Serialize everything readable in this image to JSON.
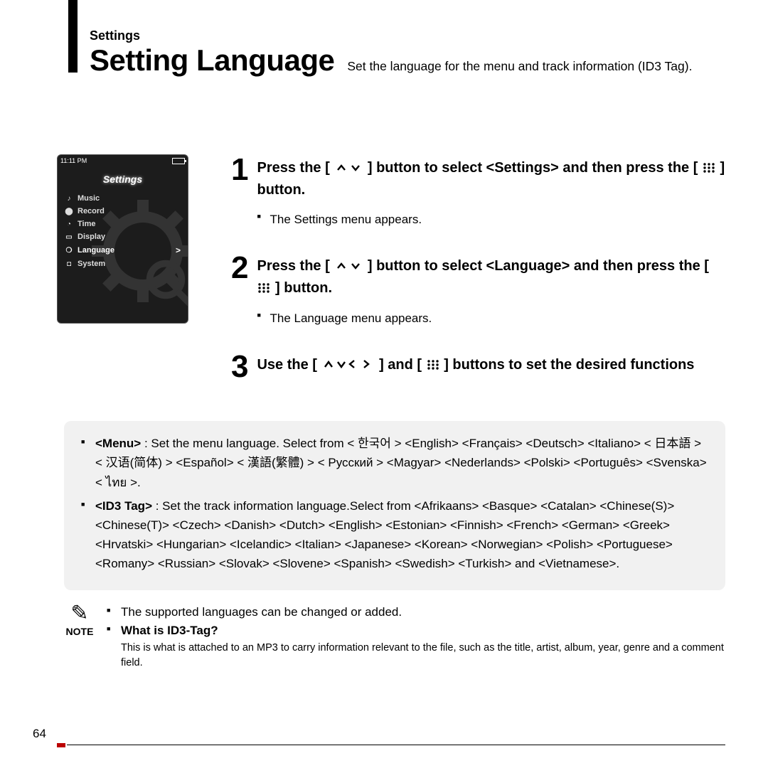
{
  "header": {
    "breadcrumb": "Settings",
    "title": "Setting Language",
    "subtitle": "Set the language for the menu and track information (ID3 Tag)."
  },
  "device": {
    "time": "11:11 PM",
    "screen_title": "Settings",
    "menu": [
      {
        "icon": "♪",
        "label": "Music"
      },
      {
        "icon": "⬤",
        "label": "Record"
      },
      {
        "icon": "◔",
        "label": "Time"
      },
      {
        "icon": "▭",
        "label": "Display"
      },
      {
        "icon": "❍",
        "label": "Language",
        "selected": true
      },
      {
        "icon": "◘",
        "label": "System"
      }
    ]
  },
  "steps": {
    "s1": {
      "num": "1",
      "line_a": "Press the [",
      "line_b": "] button to select <Settings> and then press the [",
      "line_c": "] button.",
      "bullet": "The Settings menu appears."
    },
    "s2": {
      "num": "2",
      "line_a": "Press the [",
      "line_b": "] button to select <Language> and then press the [",
      "line_c": "] button.",
      "bullet": "The Language menu appears."
    },
    "s3": {
      "num": "3",
      "line_a": "Use the [",
      "line_b": "] and [",
      "line_c": "] buttons to set the desired functions"
    }
  },
  "options": {
    "menu_label": "<Menu>",
    "menu_text": " : Set the menu language. Select from < 한국어 > <English> <Français> <Deutsch> <Italiano> < 日本語 > < 汉语(简体) > <Español> < 漢語(繁體) > < Русский > <Magyar> <Nederlands> <Polski> <Português> <Svenska> < ไทย >.",
    "id3_label": "<ID3 Tag>",
    "id3_text": " : Set the track information language.Select from <Afrikaans> <Basque> <Catalan> <Chinese(S)> <Chinese(T)> <Czech> <Danish> <Dutch> <English> <Estonian> <Finnish> <French> <German> <Greek> <Hrvatski> <Hungarian> <Icelandic> <Italian> <Japanese> <Korean> <Norwegian> <Polish> <Portuguese> <Romany> <Russian> <Slovak> <Slovene> <Spanish> <Swedish> <Turkish> and <Vietnamese>."
  },
  "note": {
    "label": "NOTE",
    "line1": "The supported languages can be changed or added.",
    "q": "What is ID3-Tag?",
    "expl": "This is what is attached to an MP3 to carry information relevant to the file, such as the title, artist, album, year, genre and a comment field."
  },
  "page_number": "64"
}
